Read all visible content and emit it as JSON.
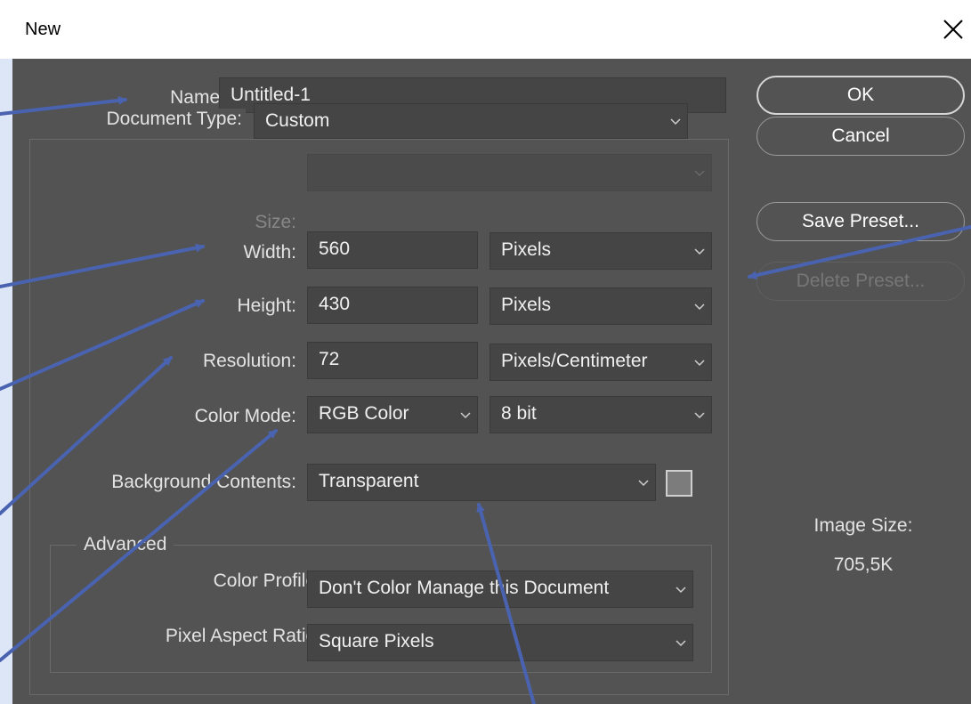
{
  "window": {
    "title": "New",
    "close_icon": "close-icon"
  },
  "form": {
    "name_label": "Name:",
    "name_value": "Untitled-1",
    "document_type_label": "Document Type:",
    "document_type_value": "Custom",
    "size_label": "Size:",
    "size_value": "",
    "width_label": "Width:",
    "width_value": "560",
    "width_unit": "Pixels",
    "height_label": "Height:",
    "height_value": "430",
    "height_unit": "Pixels",
    "resolution_label": "Resolution:",
    "resolution_value": "72",
    "resolution_unit": "Pixels/Centimeter",
    "color_mode_label": "Color Mode:",
    "color_mode_value": "RGB Color",
    "bit_depth_value": "8 bit",
    "background_label": "Background Contents:",
    "background_value": "Transparent",
    "background_swatch_color": "#7c7c7c"
  },
  "advanced": {
    "legend": "Advanced",
    "color_profile_label": "Color Profile:",
    "color_profile_value": "Don't Color Manage this Document",
    "pixel_aspect_label": "Pixel Aspect Ratio:",
    "pixel_aspect_value": "Square Pixels"
  },
  "buttons": {
    "ok": "OK",
    "cancel": "Cancel",
    "save_preset": "Save Preset...",
    "delete_preset": "Delete Preset..."
  },
  "image_size": {
    "label": "Image Size:",
    "value": "705,5K"
  },
  "colors": {
    "dialog_bg": "#535353",
    "field_bg": "#454545",
    "annotation_arrow": "#4a63b0",
    "page_bg": "#dce6f7"
  }
}
